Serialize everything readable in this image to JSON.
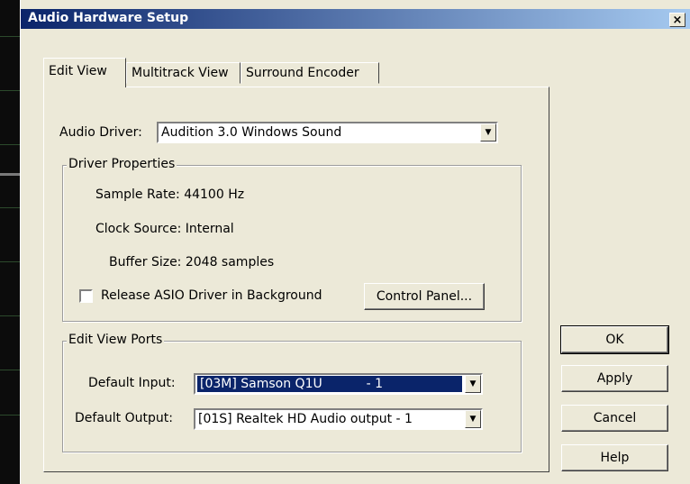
{
  "window": {
    "title": "Audio Hardware Setup",
    "close_label": "×"
  },
  "tabs": [
    "Edit View",
    "Multitrack View",
    "Surround Encoder"
  ],
  "audio_driver": {
    "label": "Audio Driver:",
    "value": "Audition 3.0 Windows Sound"
  },
  "driver_properties": {
    "legend": "Driver Properties",
    "sample_rate": "Sample Rate: 44100 Hz",
    "clock_source": "Clock Source: Internal",
    "buffer_size": "Buffer Size: 2048 samples",
    "release_asio_label": "Release ASIO Driver in Background",
    "release_asio_checked": false,
    "control_panel_label": "Control Panel..."
  },
  "edit_view_ports": {
    "legend": "Edit View Ports",
    "default_input_label": "Default Input:",
    "default_input_value": "[03M] Samson Q1U           - 1",
    "default_output_label": "Default Output:",
    "default_output_value": "[01S] Realtek HD Audio output - 1"
  },
  "buttons": {
    "ok": "OK",
    "apply": "Apply",
    "cancel": "Cancel",
    "help": "Help"
  },
  "icons": {
    "dropdown": "▼"
  },
  "colors": {
    "selection": "#0a246a",
    "title_gradient_start": "#0a246a",
    "face": "#ece9d8"
  }
}
